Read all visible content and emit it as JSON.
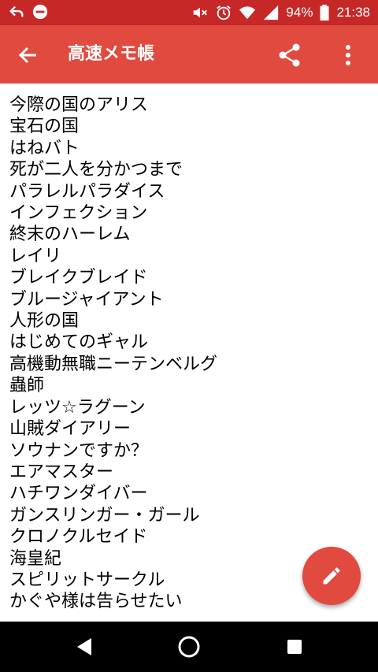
{
  "status_bar": {
    "battery": "94%",
    "time": "21:38",
    "icons": [
      "back-arrow-icon",
      "do-not-disturb-icon",
      "mute-icon",
      "alarm-icon",
      "wifi-icon",
      "signal-icon",
      "battery-icon"
    ]
  },
  "toolbar": {
    "title": "高速メモ帳",
    "icons": [
      "back-arrow-icon",
      "share-icon",
      "more-vert-icon"
    ]
  },
  "memo": {
    "lines": [
      "今際の国のアリス",
      "宝石の国",
      "はねバト",
      "死が二人を分かつまで",
      "パラレルパラダイス",
      "インフェクション",
      "終末のハーレム",
      "レイリ",
      "ブレイクブレイド",
      "ブルージャイアント",
      "人形の国",
      "はじめてのギャル",
      "高機動無職ニーテンベルグ",
      "蟲師",
      "レッツ☆ラグーン",
      "山賊ダイアリー",
      "ソウナンですか？",
      "エアマスター",
      "ハチワンダイバー",
      "ガンスリンガー・ガール",
      "クロノクルセイド",
      "海皇紀",
      "スピリットサークル",
      "かぐや様は告らせたい"
    ]
  },
  "fab": {
    "icon": "pencil-edit-icon"
  },
  "nav_bar": {
    "icons": [
      "nav-back-icon",
      "nav-home-icon",
      "nav-recents-icon"
    ]
  },
  "colors": {
    "status_bar": "#c62828",
    "toolbar": "#e04a3f",
    "fab": "#e04a3f",
    "nav_bar": "#000000"
  }
}
